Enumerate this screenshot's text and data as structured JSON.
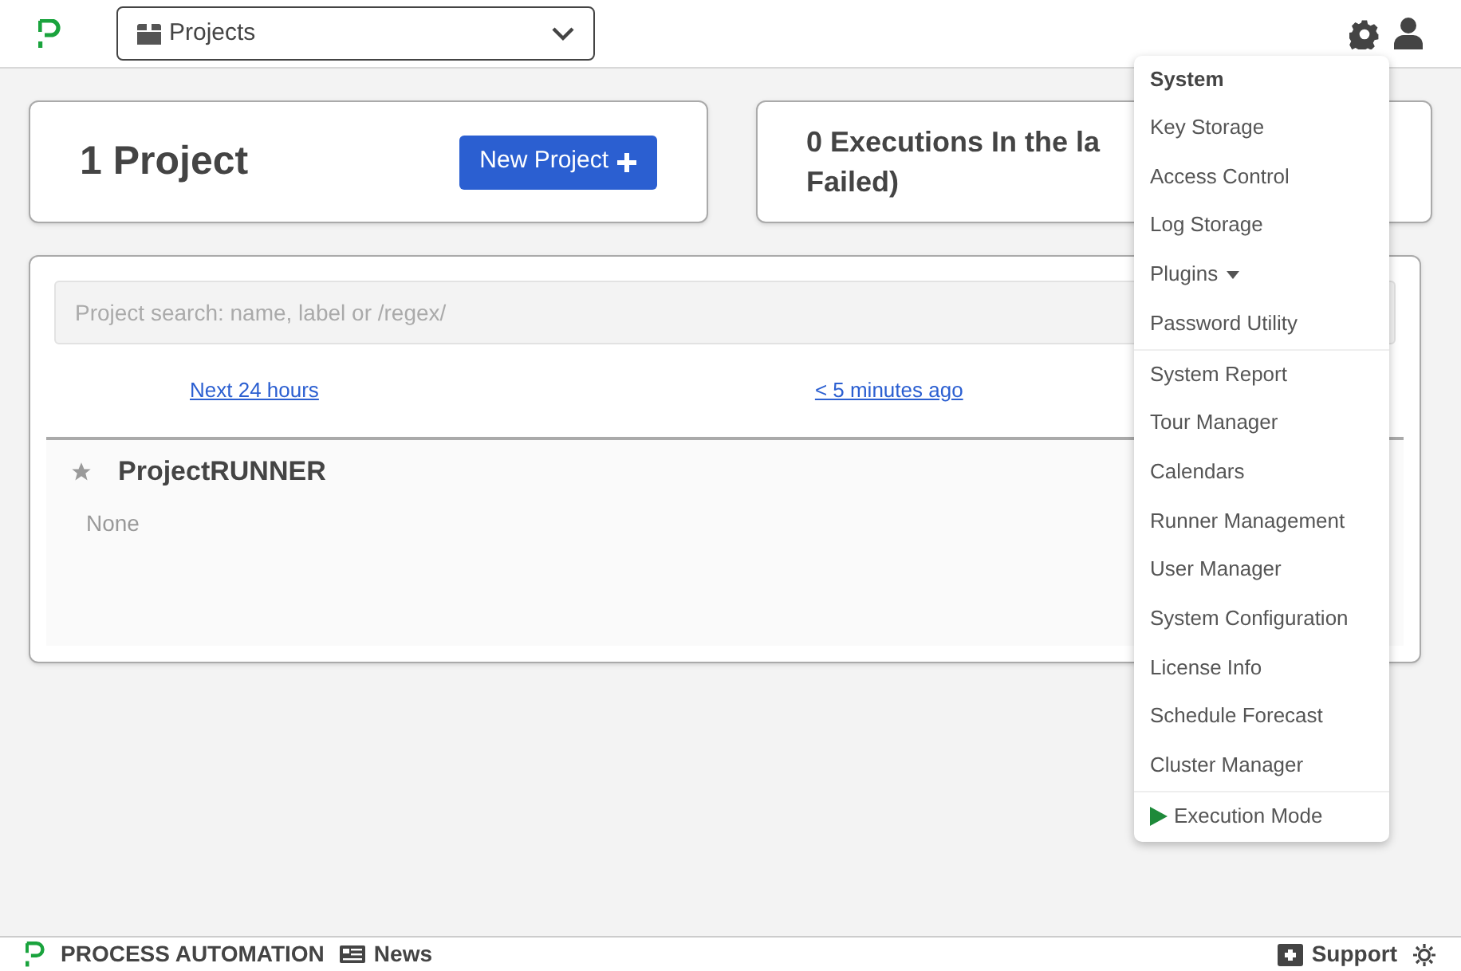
{
  "header": {
    "project_selector": "Projects"
  },
  "summary": {
    "project_count": "1 Project",
    "new_project_button": "New Project",
    "executions_lines": [
      "0 Executions In the la",
      "Failed)"
    ]
  },
  "projects_panel": {
    "search": {
      "placeholder": "Project search: name, label or /regex/"
    },
    "links": [
      "Next 24 hours",
      "< 5 minutes ago"
    ],
    "projects": [
      {
        "name": "ProjectRUNNER",
        "starred": false,
        "description": "None"
      }
    ]
  },
  "system_menu": {
    "items": [
      {
        "kind": "header",
        "label": "System",
        "divider_before": false
      },
      {
        "kind": "item",
        "label": "Key Storage",
        "divider_before": false
      },
      {
        "kind": "item",
        "label": "Access Control",
        "divider_before": false
      },
      {
        "kind": "item",
        "label": "Log Storage",
        "divider_before": false
      },
      {
        "kind": "dropdown",
        "label": "Plugins",
        "divider_before": false
      },
      {
        "kind": "item",
        "label": "Password Utility",
        "divider_before": false
      },
      {
        "kind": "item",
        "label": "System Report",
        "divider_before": true
      },
      {
        "kind": "item",
        "label": "Tour Manager",
        "divider_before": false
      },
      {
        "kind": "item",
        "label": "Calendars",
        "divider_before": false
      },
      {
        "kind": "item",
        "label": "Runner Management",
        "divider_before": false
      },
      {
        "kind": "item",
        "label": "User Manager",
        "divider_before": false
      },
      {
        "kind": "item",
        "label": "System Configuration",
        "divider_before": false
      },
      {
        "kind": "item",
        "label": "License Info",
        "divider_before": false
      },
      {
        "kind": "item",
        "label": "Schedule Forecast",
        "divider_before": false
      },
      {
        "kind": "item",
        "label": "Cluster Manager",
        "divider_before": false
      },
      {
        "kind": "mode",
        "label": "Execution Mode",
        "divider_before": true
      }
    ]
  },
  "footer": {
    "brand": "PROCESS AUTOMATION",
    "news": "News",
    "support": "Support"
  }
}
